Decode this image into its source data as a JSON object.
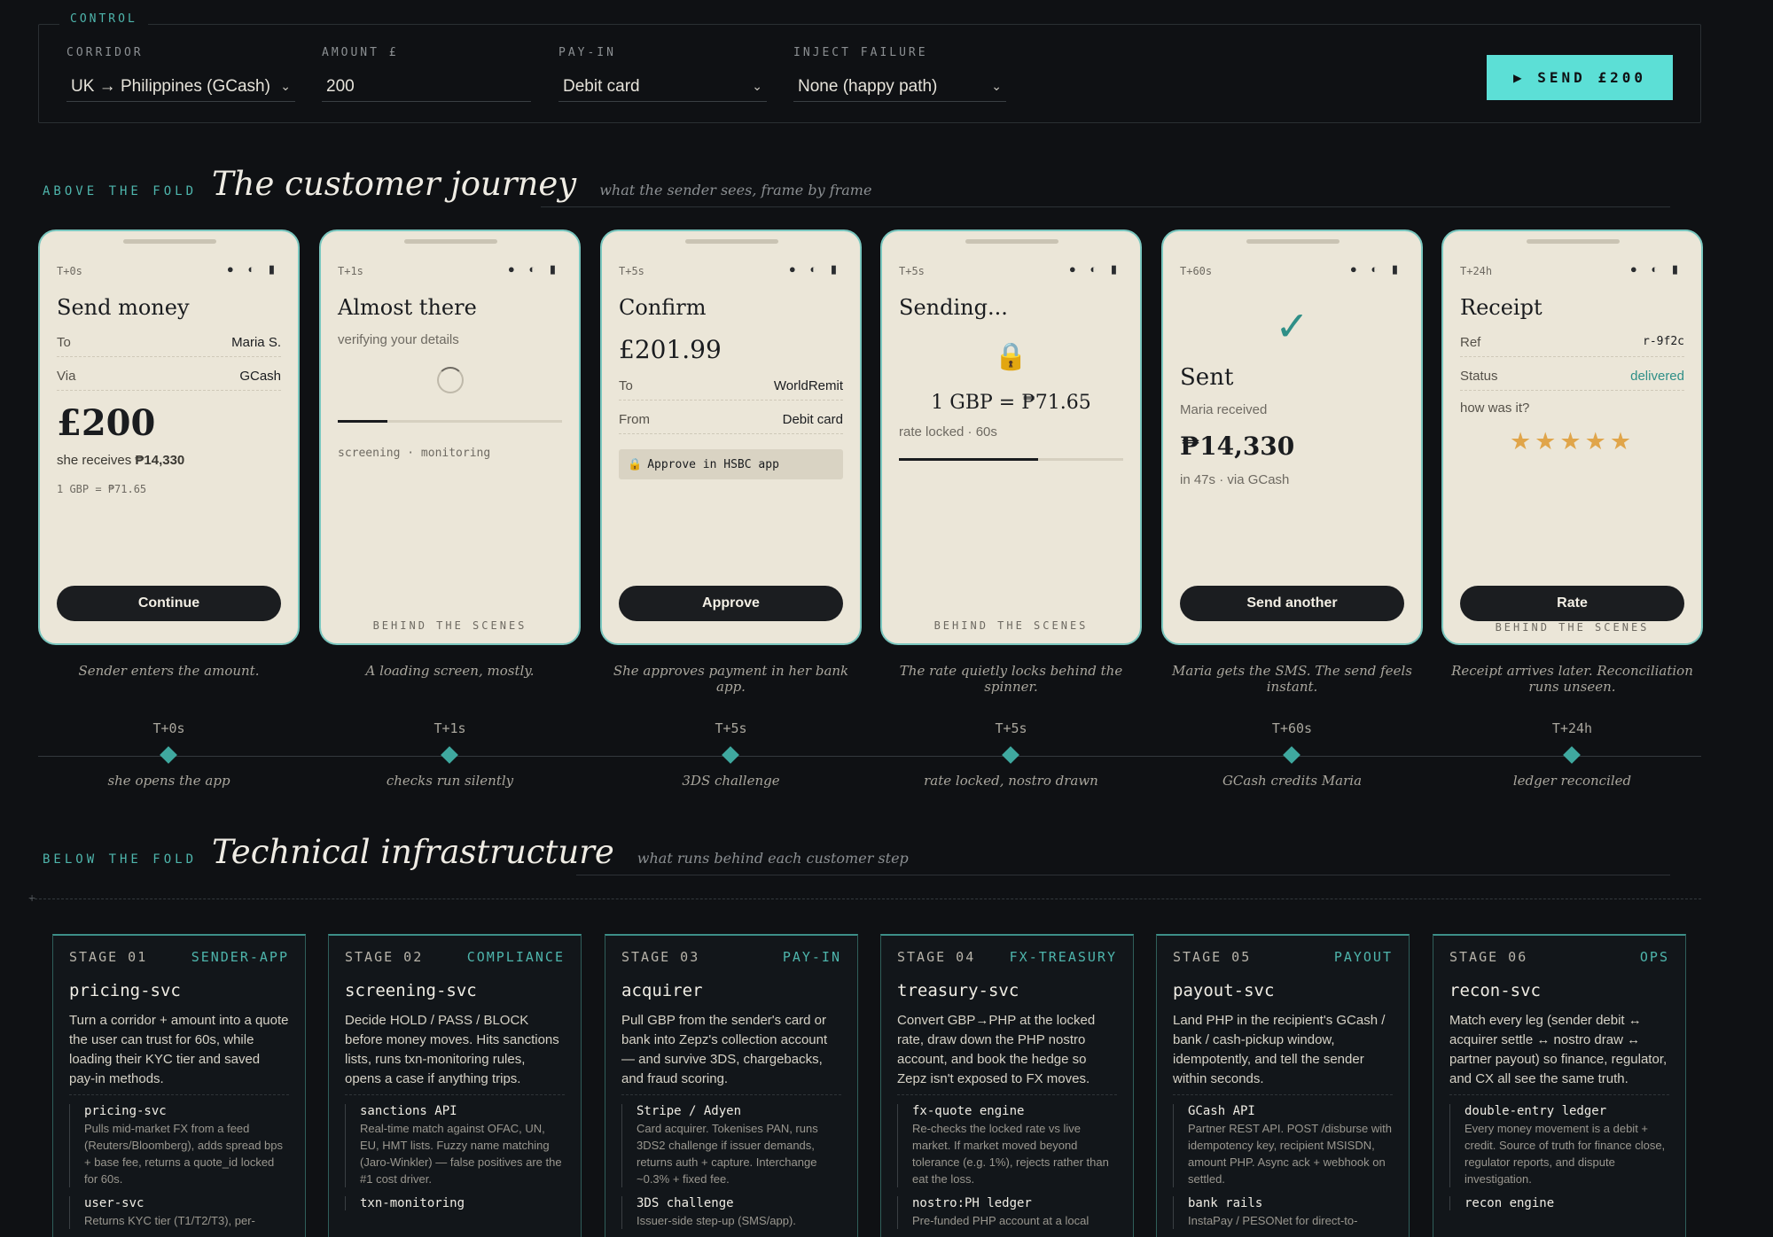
{
  "control": {
    "label": "CONTROL",
    "corridor_label": "CORRIDOR",
    "corridor_value": "UK → Philippines (GCash)",
    "amount_label": "AMOUNT £",
    "amount_value": "200",
    "payin_label": "PAY-IN",
    "payin_value": "Debit card",
    "inject_label": "INJECT FAILURE",
    "inject_value": "None (happy path)",
    "send_label": "▶ SEND £200"
  },
  "journey": {
    "kicker": "ABOVE THE FOLD",
    "title": "The customer journey",
    "subtitle": "what the sender sees, frame by frame"
  },
  "phones": {
    "p1": {
      "time": "T+0s",
      "title": "Send money",
      "to_k": "To",
      "to_v": "Maria S.",
      "via_k": "Via",
      "via_v": "GCash",
      "amount": "£200",
      "receives_pre": "she receives ",
      "receives_amt": "₱14,330",
      "rate": "1 GBP = ₱71.65",
      "button": "Continue",
      "caption": "Sender enters the amount."
    },
    "p2": {
      "time": "T+1s",
      "title": "Almost there",
      "sub": "verifying your details",
      "progress": 0.22,
      "status": "screening · monitoring",
      "behind": "BEHIND THE SCENES",
      "caption": "A loading screen, mostly."
    },
    "p3": {
      "time": "T+5s",
      "title": "Confirm",
      "amount": "£201.99",
      "to_k": "To",
      "to_v": "WorldRemit",
      "from_k": "From",
      "from_v": "Debit card",
      "approve_note": "Approve in HSBC app",
      "button": "Approve",
      "caption": "She approves payment in her bank app."
    },
    "p4": {
      "time": "T+5s",
      "title": "Sending...",
      "rate": "1 GBP = ₱71.65",
      "locked": "rate locked · 60s",
      "progress": 0.62,
      "behind": "BEHIND THE SCENES",
      "caption": "The rate quietly locks behind the spinner."
    },
    "p5": {
      "time": "T+60s",
      "title": "Sent",
      "sub": "Maria received",
      "amount": "₱14,330",
      "meta": "in 47s · via GCash",
      "button": "Send another",
      "caption": "Maria gets the SMS. The send feels instant."
    },
    "p6": {
      "time": "T+24h",
      "title": "Receipt",
      "ref_k": "Ref",
      "ref_v": "r-9f2c",
      "status_k": "Status",
      "status_v": "delivered",
      "ask": "how was it?",
      "stars": 5,
      "button": "Rate",
      "behind": "BEHIND THE SCENES",
      "caption": "Receipt arrives later. Reconciliation runs unseen."
    }
  },
  "timeline": [
    {
      "time": "T+0s",
      "caption": "she opens the app"
    },
    {
      "time": "T+1s",
      "caption": "checks run silently"
    },
    {
      "time": "T+5s",
      "caption": "3DS challenge"
    },
    {
      "time": "T+5s",
      "caption": "rate locked, nostro drawn"
    },
    {
      "time": "T+60s",
      "caption": "GCash credits Maria"
    },
    {
      "time": "T+24h",
      "caption": "ledger reconciled"
    }
  ],
  "infra": {
    "kicker": "BELOW THE FOLD",
    "title": "Technical infrastructure",
    "subtitle": "what runs behind each customer step"
  },
  "stages": [
    {
      "no": "STAGE 01",
      "tag": "SENDER-APP",
      "svc": "pricing-svc",
      "desc": "Turn a corridor + amount into a quote the user can trust for 60s, while loading their KYC tier and saved pay-in methods.",
      "subs": [
        {
          "name": "pricing-svc",
          "desc": "Pulls mid-market FX from a feed (Reuters/Bloomberg), adds spread bps + base fee, returns a quote_id locked for 60s."
        },
        {
          "name": "user-svc",
          "desc": "Returns KYC tier (T1/T2/T3), per-"
        }
      ]
    },
    {
      "no": "STAGE 02",
      "tag": "COMPLIANCE",
      "svc": "screening-svc",
      "desc": "Decide HOLD / PASS / BLOCK before money moves. Hits sanctions lists, runs txn-monitoring rules, opens a case if anything trips.",
      "subs": [
        {
          "name": "sanctions API",
          "desc": "Real-time match against OFAC, UN, EU, HMT lists. Fuzzy name matching (Jaro-Winkler) — false positives are the #1 cost driver."
        },
        {
          "name": "txn-monitoring",
          "desc": ""
        }
      ]
    },
    {
      "no": "STAGE 03",
      "tag": "PAY-IN",
      "svc": "acquirer",
      "desc": "Pull GBP from the sender's card or bank into Zepz's collection account — and survive 3DS, chargebacks, and fraud scoring.",
      "subs": [
        {
          "name": "Stripe / Adyen",
          "desc": "Card acquirer. Tokenises PAN, runs 3DS2 challenge if issuer demands, returns auth + capture. Interchange ~0.3% + fixed fee."
        },
        {
          "name": "3DS challenge",
          "desc": "Issuer-side step-up (SMS/app)."
        }
      ]
    },
    {
      "no": "STAGE 04",
      "tag": "FX-TREASURY",
      "svc": "treasury-svc",
      "desc": "Convert GBP→PHP at the locked rate, draw down the PHP nostro account, and book the hedge so Zepz isn't exposed to FX moves.",
      "subs": [
        {
          "name": "fx-quote engine",
          "desc": "Re-checks the locked rate vs live market. If market moved beyond tolerance (e.g. 1%), rejects rather than eat the loss."
        },
        {
          "name": "nostro:PH ledger",
          "desc": "Pre-funded PHP account at a local"
        }
      ]
    },
    {
      "no": "STAGE 05",
      "tag": "PAYOUT",
      "svc": "payout-svc",
      "desc": "Land PHP in the recipient's GCash / bank / cash-pickup window, idempotently, and tell the sender within seconds.",
      "subs": [
        {
          "name": "GCash API",
          "desc": "Partner REST API. POST /disburse with idempotency key, recipient MSISDN, amount PHP. Async ack + webhook on settled."
        },
        {
          "name": "bank rails",
          "desc": "InstaPay / PESONet for direct-to-"
        }
      ]
    },
    {
      "no": "STAGE 06",
      "tag": "OPS",
      "svc": "recon-svc",
      "desc": "Match every leg (sender debit ↔ acquirer settle ↔ nostro draw ↔ partner payout) so finance, regulator, and CX all see the same truth.",
      "subs": [
        {
          "name": "double-entry ledger",
          "desc": "Every money movement is a debit + credit. Source of truth for finance close, regulator reports, and dispute investigation."
        },
        {
          "name": "recon engine",
          "desc": ""
        }
      ]
    }
  ]
}
